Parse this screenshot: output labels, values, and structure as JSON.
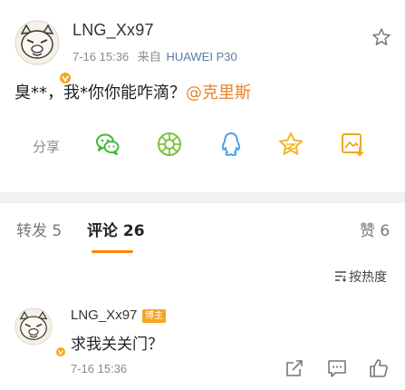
{
  "post": {
    "username": "LNG_Xx97",
    "time": "7-16 15:36",
    "source_prefix": "来自",
    "source_device": "HUAWEI P30",
    "text": "臭**，我*你你能咋滴？",
    "mention": "@克里斯",
    "share_label": "分享",
    "share_targets": [
      "wechat-icon",
      "moments-icon",
      "qq-icon",
      "qzone-icon",
      "save-image-icon"
    ]
  },
  "tabs": {
    "repost": "转发 5",
    "comments": "评论 26",
    "likes": "赞 6"
  },
  "sort": {
    "label": "按热度"
  },
  "comment": {
    "username": "LNG_Xx97",
    "badge": "博主",
    "text": "求我关关门？",
    "time": "7-16 15:36"
  },
  "colors": {
    "accent": "#ff8200",
    "badge": "#f5a623",
    "verified": "#f3a821",
    "mention": "#e8842a",
    "wechat": "#3fb838",
    "qq": "#4fa0e8"
  }
}
